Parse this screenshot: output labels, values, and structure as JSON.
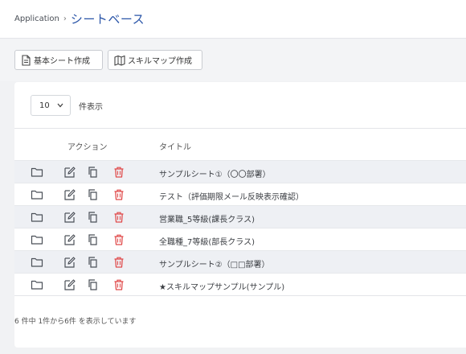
{
  "breadcrumb": {
    "app": "Application",
    "separator": "›",
    "current": "シートベース"
  },
  "toolbar": {
    "basic_sheet_label": "基本シート作成",
    "skillmap_label": "スキルマップ作成"
  },
  "length_menu": {
    "value": "10",
    "suffix": "件表示"
  },
  "table": {
    "headers": {
      "action": "アクション",
      "title": "タイトル"
    },
    "rows": [
      {
        "title": "サンプルシート①（〇〇部署）"
      },
      {
        "title": "テスト（評価期限メール反映表示確認）"
      },
      {
        "title": "営業職_5等級(課長クラス)"
      },
      {
        "title": "全職種_7等級(部長クラス)"
      },
      {
        "title": "サンプルシート②（□□部署）"
      },
      {
        "title": "★スキルマップサンプル(サンプル)"
      }
    ]
  },
  "info_text": "6 件中 1件から6件 を表示しています",
  "colors": {
    "accent": "#2a55a8",
    "delete": "#e04a4a",
    "icon": "#4a4f57",
    "row_shade": "#eef0f4"
  },
  "icons": [
    "folder-icon",
    "edit-icon",
    "copy-icon",
    "delete-icon",
    "document-icon",
    "map-icon",
    "chevron-down-icon"
  ]
}
